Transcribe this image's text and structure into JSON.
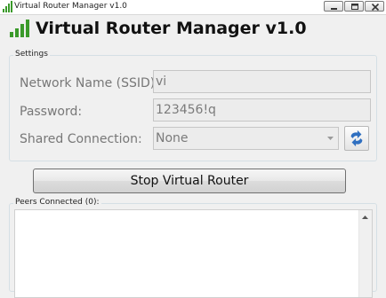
{
  "window": {
    "title": "Virtual Router Manager v1.0"
  },
  "header": {
    "title": "Virtual Router Manager v1.0"
  },
  "settings": {
    "group_label": "Settings",
    "ssid_label": "Network Name (SSID):",
    "ssid_value": "vi",
    "password_label": "Password:",
    "password_value": "123456!q",
    "shared_connection_label": "Shared Connection:",
    "shared_connection_value": "None"
  },
  "actions": {
    "stop_label": "Stop Virtual Router"
  },
  "peers": {
    "group_label": "Peers Connected (0):"
  },
  "colors": {
    "accent_blue": "#2f6fc0",
    "signal_green": "#3a9a2a"
  }
}
